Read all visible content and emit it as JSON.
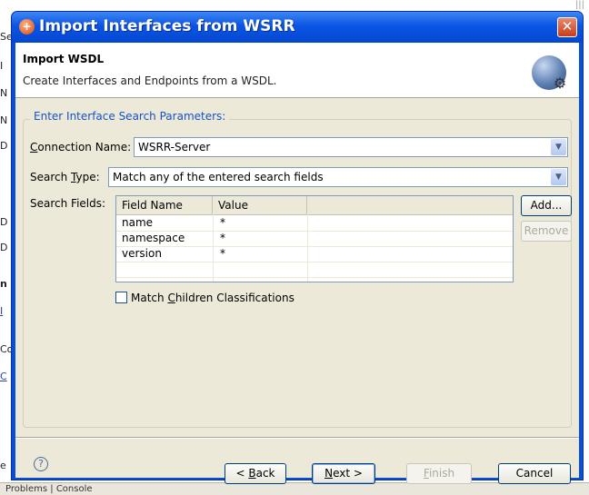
{
  "background": {
    "glyphs": [
      "Se",
      "I",
      "N",
      "N",
      "D",
      "D",
      "D",
      "n",
      "I",
      "Co",
      "C",
      "e"
    ],
    "bottom_tab": "Problems | Console"
  },
  "dialog": {
    "title": "Import Interfaces from WSRR",
    "close_label": "✕",
    "header_title": "Import WSDL",
    "header_desc": "Create Interfaces and Endpoints from a WSDL."
  },
  "group": {
    "label": "Enter Interface Search Parameters:",
    "connection_label": "Connection Name:",
    "connection_value": "WSRR-Server",
    "search_type_label": "Search Type:",
    "search_type_value": "Match any of the entered search fields",
    "search_fields_label": "Search Fields:"
  },
  "table": {
    "columns": [
      "Field Name",
      "Value"
    ],
    "rows": [
      {
        "field": "name",
        "value": "*"
      },
      {
        "field": "namespace",
        "value": "*"
      },
      {
        "field": "version",
        "value": "*"
      }
    ]
  },
  "side_buttons": {
    "add": "Add...",
    "remove": "Remove"
  },
  "checkbox": {
    "label": "Match Children Classifications",
    "checked": false
  },
  "footer": {
    "help": "?",
    "back": "< Back",
    "next": "Next >",
    "finish": "Finish",
    "cancel": "Cancel"
  }
}
